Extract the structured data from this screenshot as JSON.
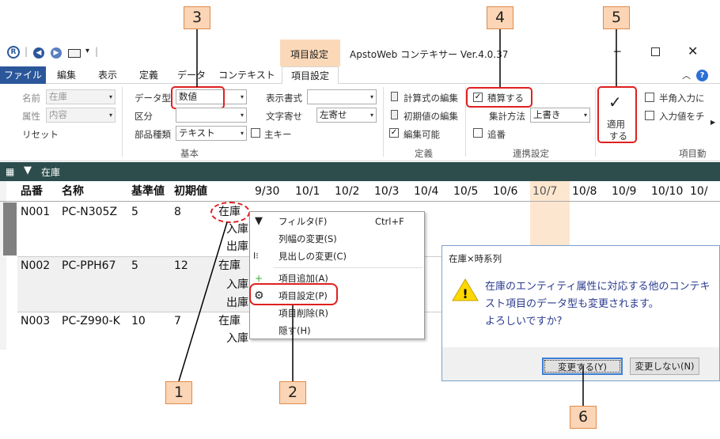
{
  "callouts": [
    "1",
    "2",
    "3",
    "4",
    "5",
    "6"
  ],
  "titlebar": {
    "contextual_tab": "項目設定",
    "title": "ApstoWeb コンテキサー Ver.4.0.37"
  },
  "tabs": [
    "ファイル",
    "編集",
    "表示",
    "定義",
    "データ",
    "コンテキスト",
    "項目設定"
  ],
  "ribbon": {
    "name_label": "名前",
    "name_value": "在庫",
    "attr_label": "属性",
    "attr_value": "内容",
    "reset": "リセット",
    "datatype_label": "データ型",
    "datatype_value": "数値",
    "category_label": "区分",
    "parttype_label": "部品種類",
    "parttype_value": "テキスト",
    "primarykey": "主キー",
    "display_format_label": "表示書式",
    "text_align_label": "文字寄せ",
    "text_align_value": "左寄せ",
    "group_basic": "基本",
    "edit_formula": "計算式の編集",
    "edit_initial": "初期値の編集",
    "editable": "編集可能",
    "group_definition": "定義",
    "accumulate": "積算する",
    "agg_method_label": "集計方法",
    "agg_method_value": "上書き",
    "append": "追番",
    "group_link": "連携設定",
    "apply": "適用\nする",
    "apply_l1": "適用",
    "apply_l2": "する",
    "halfwidth": "半角入力に",
    "input_check": "入力値をチ",
    "group_item": "項目動"
  },
  "gridbar": {
    "title": "在庫"
  },
  "grid": {
    "headers": [
      "品番",
      "名称",
      "基準値",
      "初期値"
    ],
    "dates": [
      "9/30",
      "10/1",
      "10/2",
      "10/3",
      "10/4",
      "10/5",
      "10/6",
      "10/7",
      "10/8",
      "10/9",
      "10/10",
      "10/"
    ],
    "rows": [
      {
        "code": "N001",
        "name": "PC-N305Z",
        "base": "5",
        "init": "8",
        "attrs": [
          "在庫",
          "入庫",
          "出庫"
        ]
      },
      {
        "code": "N002",
        "name": "PC-PPH67",
        "base": "5",
        "init": "12",
        "attrs": [
          "在庫",
          "入庫",
          "出庫"
        ]
      },
      {
        "code": "N003",
        "name": "PC-Z990-K",
        "base": "10",
        "init": "7",
        "attrs": [
          "在庫",
          "入庫"
        ]
      }
    ]
  },
  "menu": {
    "items": [
      {
        "label": "フィルタ(F)",
        "shortcut": "Ctrl+F"
      },
      {
        "label": "列幅の変更(S)"
      },
      {
        "label": "見出しの変更(C)"
      },
      {
        "label": "項目追加(A)"
      },
      {
        "label": "項目設定(P)"
      },
      {
        "label": "項目削除(R)"
      },
      {
        "label": "隠す(H)"
      }
    ]
  },
  "dialog": {
    "title": "在庫×時系列",
    "message": "在庫のエンティティ属性に対応する他のコンテキスト項目のデータ型も変更されます。よろしいですか?",
    "msg_l1": "在庫のエンティティ属性に対応する他のコンテキ",
    "msg_l2": "スト項目のデータ型も変更されます。",
    "msg_l3": "よろしいですか?",
    "ok": "変更する(Y)",
    "cancel": "変更しない(N)"
  },
  "colors": {
    "file_tab": "#2b579a",
    "context_tab": "#fbd9b8",
    "callout": "#fbd5b5",
    "highlight": "#e02020",
    "grid_header_bar": "#2d4d4d",
    "today_col": "#fde6cf"
  }
}
